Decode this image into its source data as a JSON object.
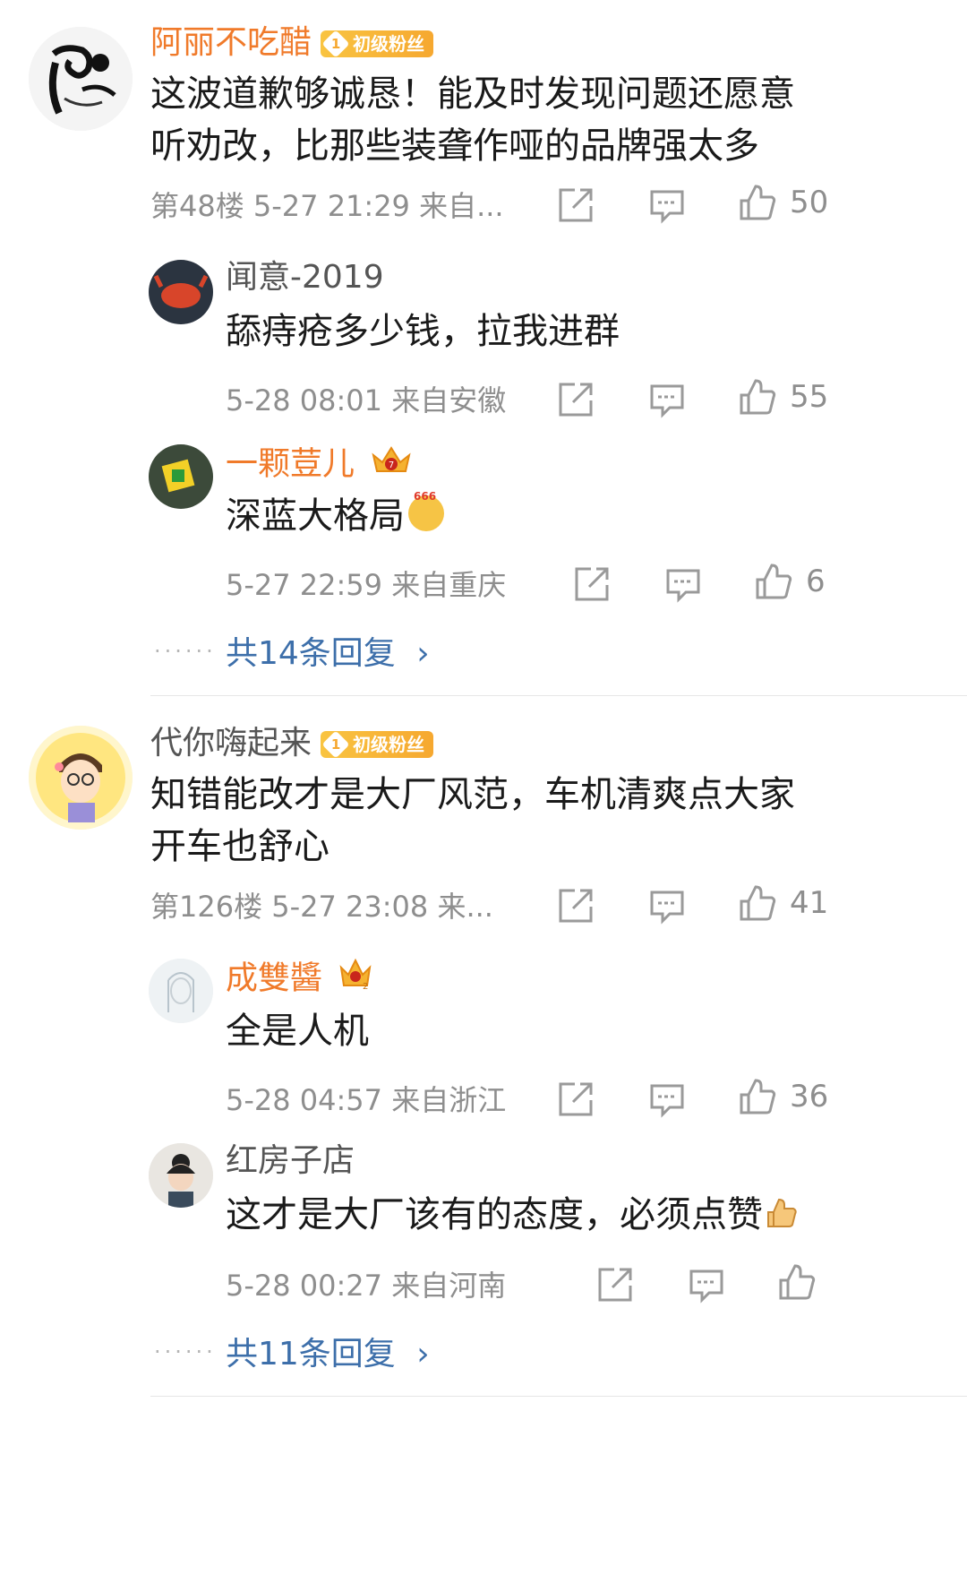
{
  "comments": [
    {
      "username": "阿丽不吃醋",
      "badge": "初级粉丝",
      "text_line1": "这波道歉够诚恳！能及时发现问题还愿意",
      "text_line2": "听劝改，比那些装聋作哑的品牌强太多",
      "meta": "第48楼  5-27 21:29  来自...",
      "likes": "50",
      "replies": [
        {
          "username": "闻意-2019",
          "text": "舔痔疮多少钱，拉我进群",
          "meta": "5-28 08:01  来自安徽",
          "likes": "55"
        },
        {
          "username": "一颗荳儿",
          "text": "深蓝大格局",
          "emoji_label": "666",
          "meta": "5-27 22:59  来自重庆",
          "likes": "6"
        }
      ],
      "more_dots": "......",
      "more_replies": "共14条回复",
      "more_arrow": "›"
    },
    {
      "username": "代你嗨起来",
      "badge": "初级粉丝",
      "text_line1": "知错能改才是大厂风范，车机清爽点大家",
      "text_line2": "开车也舒心",
      "meta": "第126楼  5-27 23:08  来...",
      "likes": "41",
      "replies": [
        {
          "username": "成雙醬",
          "text": "全是人机",
          "meta": "5-28 04:57  来自浙江",
          "likes": "36"
        },
        {
          "username": "红房子店",
          "text": "这才是大厂该有的态度，必须点赞",
          "meta": "5-28 00:27  来自河南",
          "likes": ""
        }
      ],
      "more_dots": "......",
      "more_replies": "共11条回复",
      "more_arrow": "›"
    }
  ],
  "badge_level": "1",
  "crown_level_1": "7",
  "crown_level_2": "2",
  "colors": {
    "vip_name": "#f07a2a",
    "link": "#3d6faa",
    "meta_gray": "#8e8e8e",
    "badge": "#f6a830"
  }
}
